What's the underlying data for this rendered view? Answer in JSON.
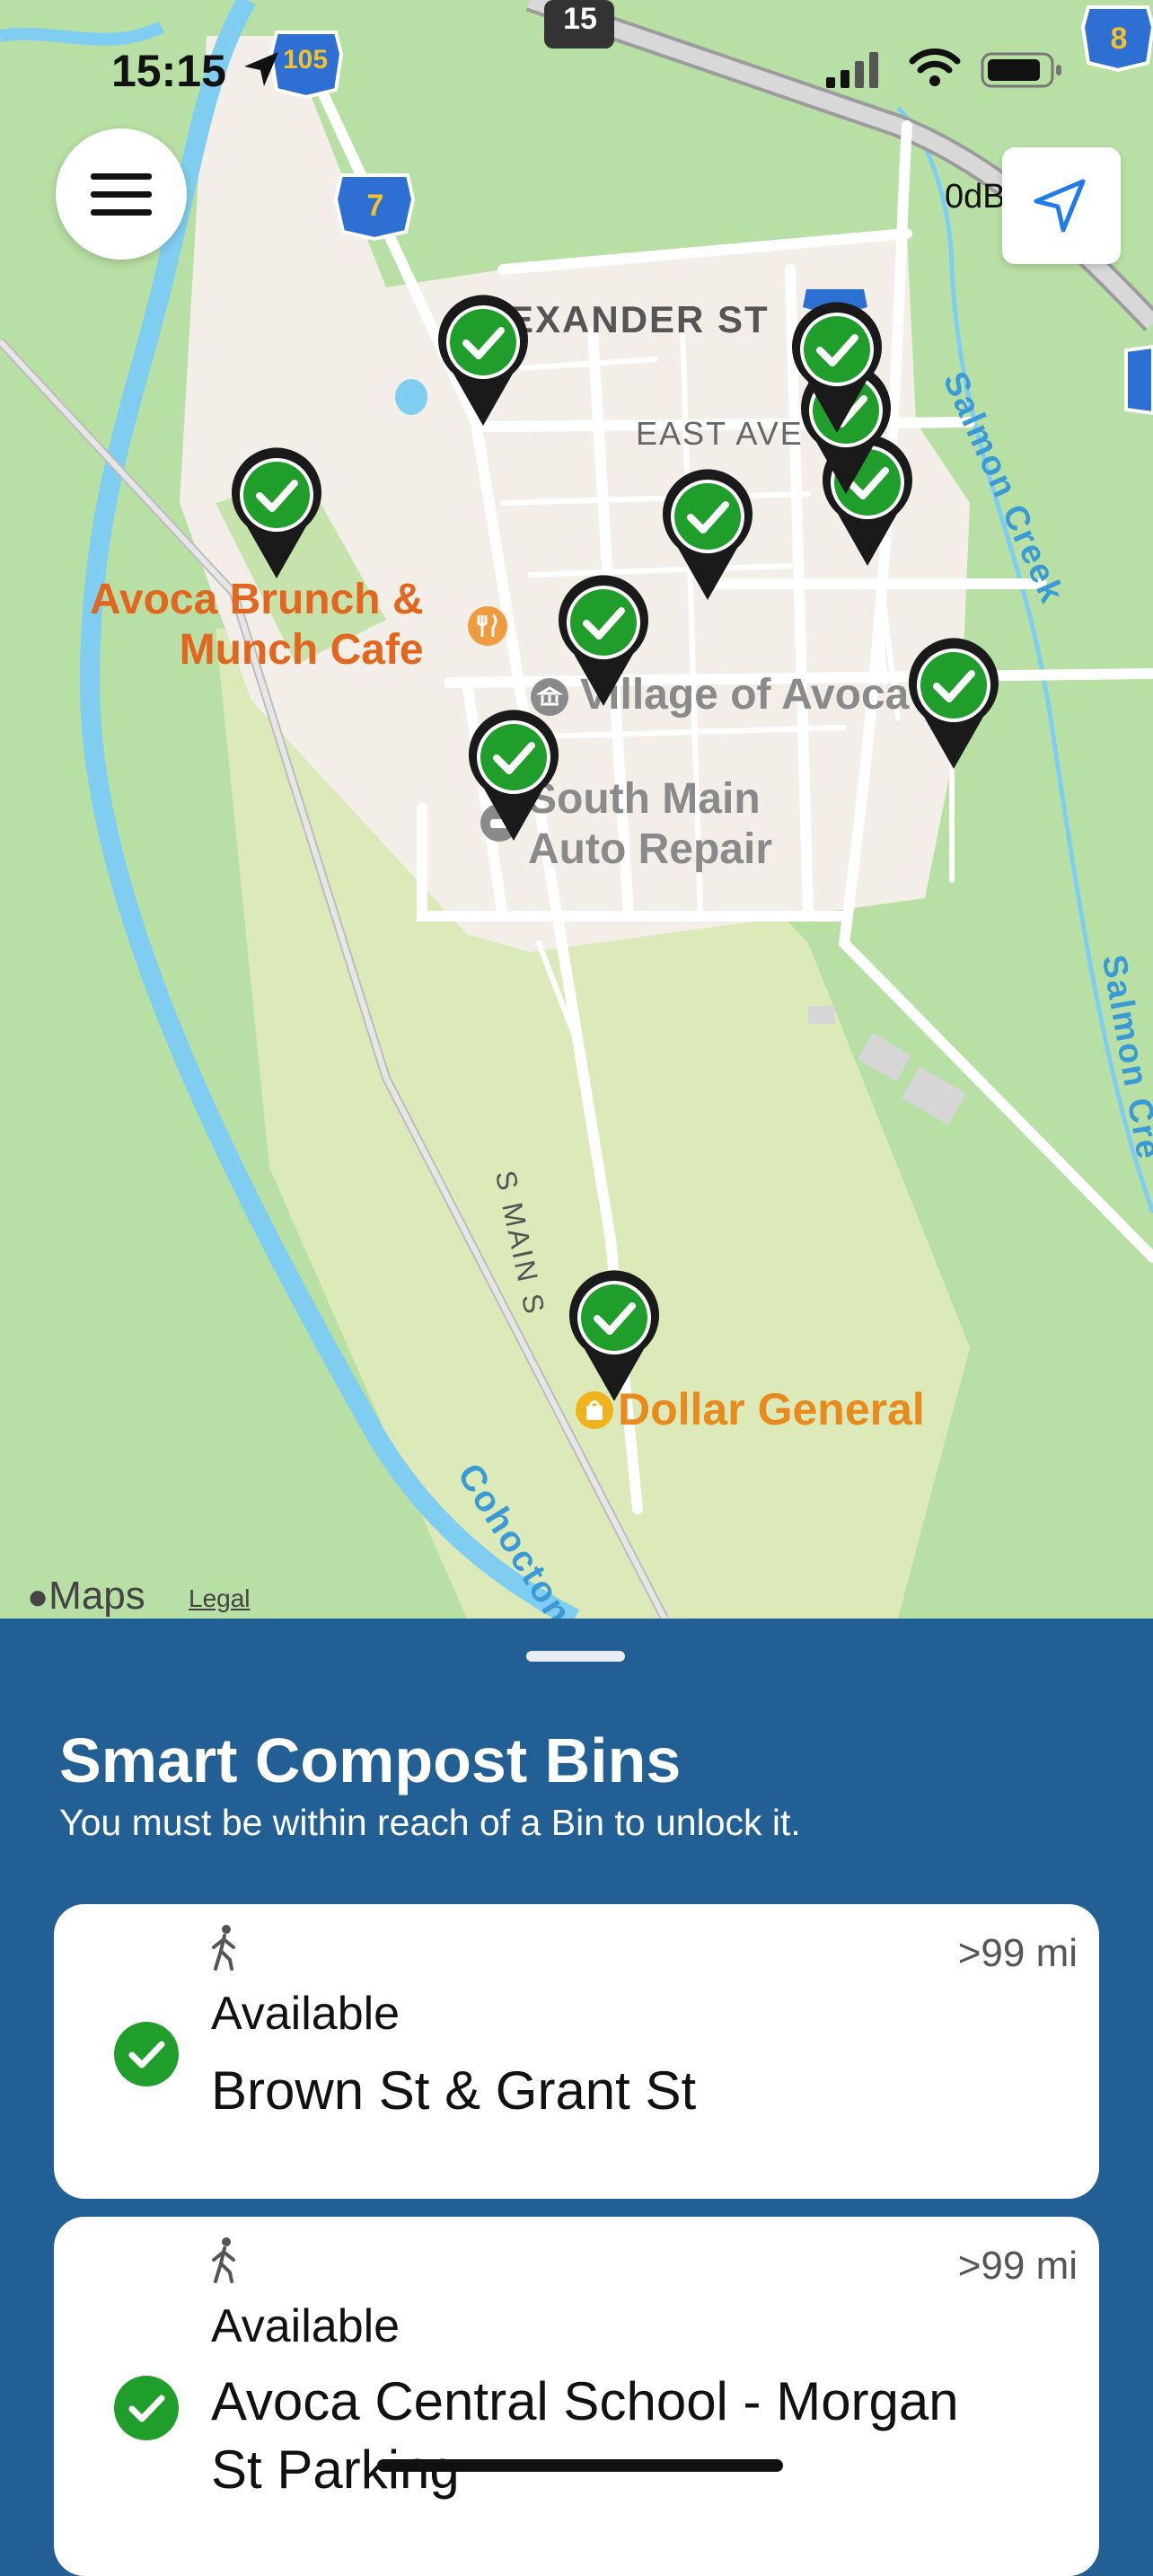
{
  "status_bar": {
    "time": "15:15"
  },
  "map": {
    "shields": [
      "105",
      "15",
      "7",
      "8"
    ],
    "db_label": "0dB",
    "streets": [
      "EXANDER ST",
      "EAST AVE",
      "S MAIN S",
      "Salmon Creek",
      "Salmon Cre",
      "Cohocton"
    ],
    "pois": {
      "cafe_line1": "Avoca Brunch &",
      "cafe_line2": "Munch Cafe",
      "village": "Village of Avoca",
      "repair_line1": "South Main",
      "repair_line2": "Auto Repair",
      "dollar": "Dollar General"
    },
    "attribution": "Maps",
    "legal": "Legal",
    "pin_count": 10
  },
  "panel": {
    "title": "Smart Compost Bins",
    "subtitle": "You must be within reach of a Bin to unlock it.",
    "bins": [
      {
        "distance": ">99 mi",
        "status": "Available",
        "name": "Brown St & Grant St"
      },
      {
        "distance": ">99 mi",
        "status": "Available",
        "name": "Avoca Central School - Morgan St Parking"
      }
    ]
  },
  "colors": {
    "panel_bg": "#215f94",
    "pin_green": "#1f9e2c",
    "poi_orange": "#e2661e"
  }
}
